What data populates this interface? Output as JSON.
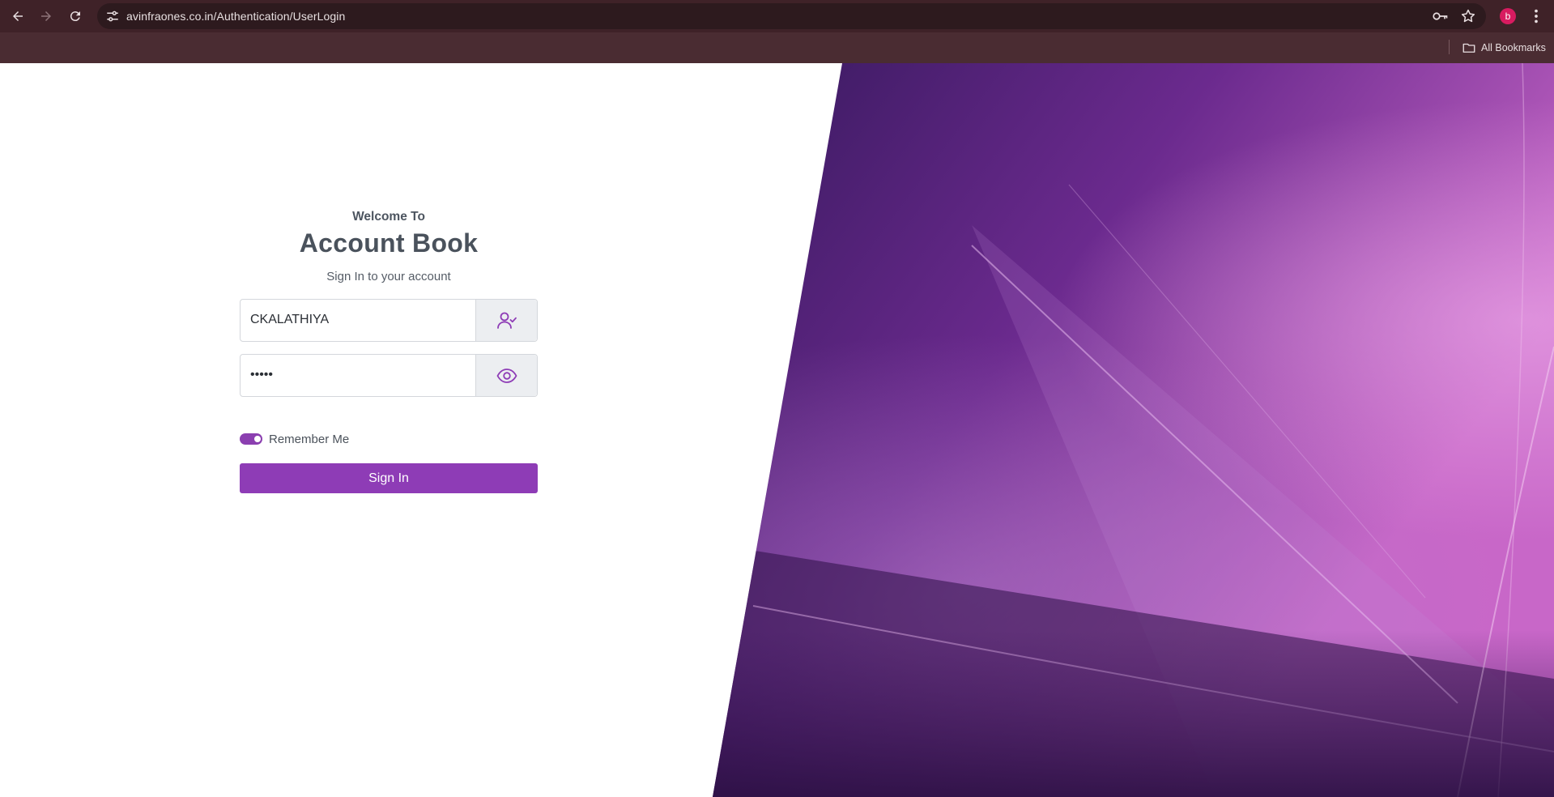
{
  "browser": {
    "url": "avinfraones.co.in/Authentication/UserLogin",
    "profile_initial": "b",
    "bookmarks_label": "All Bookmarks",
    "icons": [
      "back-icon",
      "forward-icon",
      "reload-icon",
      "site-settings-icon",
      "key-icon",
      "star-icon",
      "menu-icon",
      "folder-icon"
    ]
  },
  "login": {
    "welcome": "Welcome To",
    "title": "Account Book",
    "subtitle": "Sign In to your account",
    "username_value": "CKALATHIYA",
    "password_value": "•••••",
    "remember_label": "Remember Me",
    "remember_checked": true,
    "signin_label": "Sign In"
  },
  "colors": {
    "accent": "#8e3cb6",
    "toolbar": "#3f2228",
    "hero_dark": "#12092a",
    "hero_light": "#c164c9"
  }
}
